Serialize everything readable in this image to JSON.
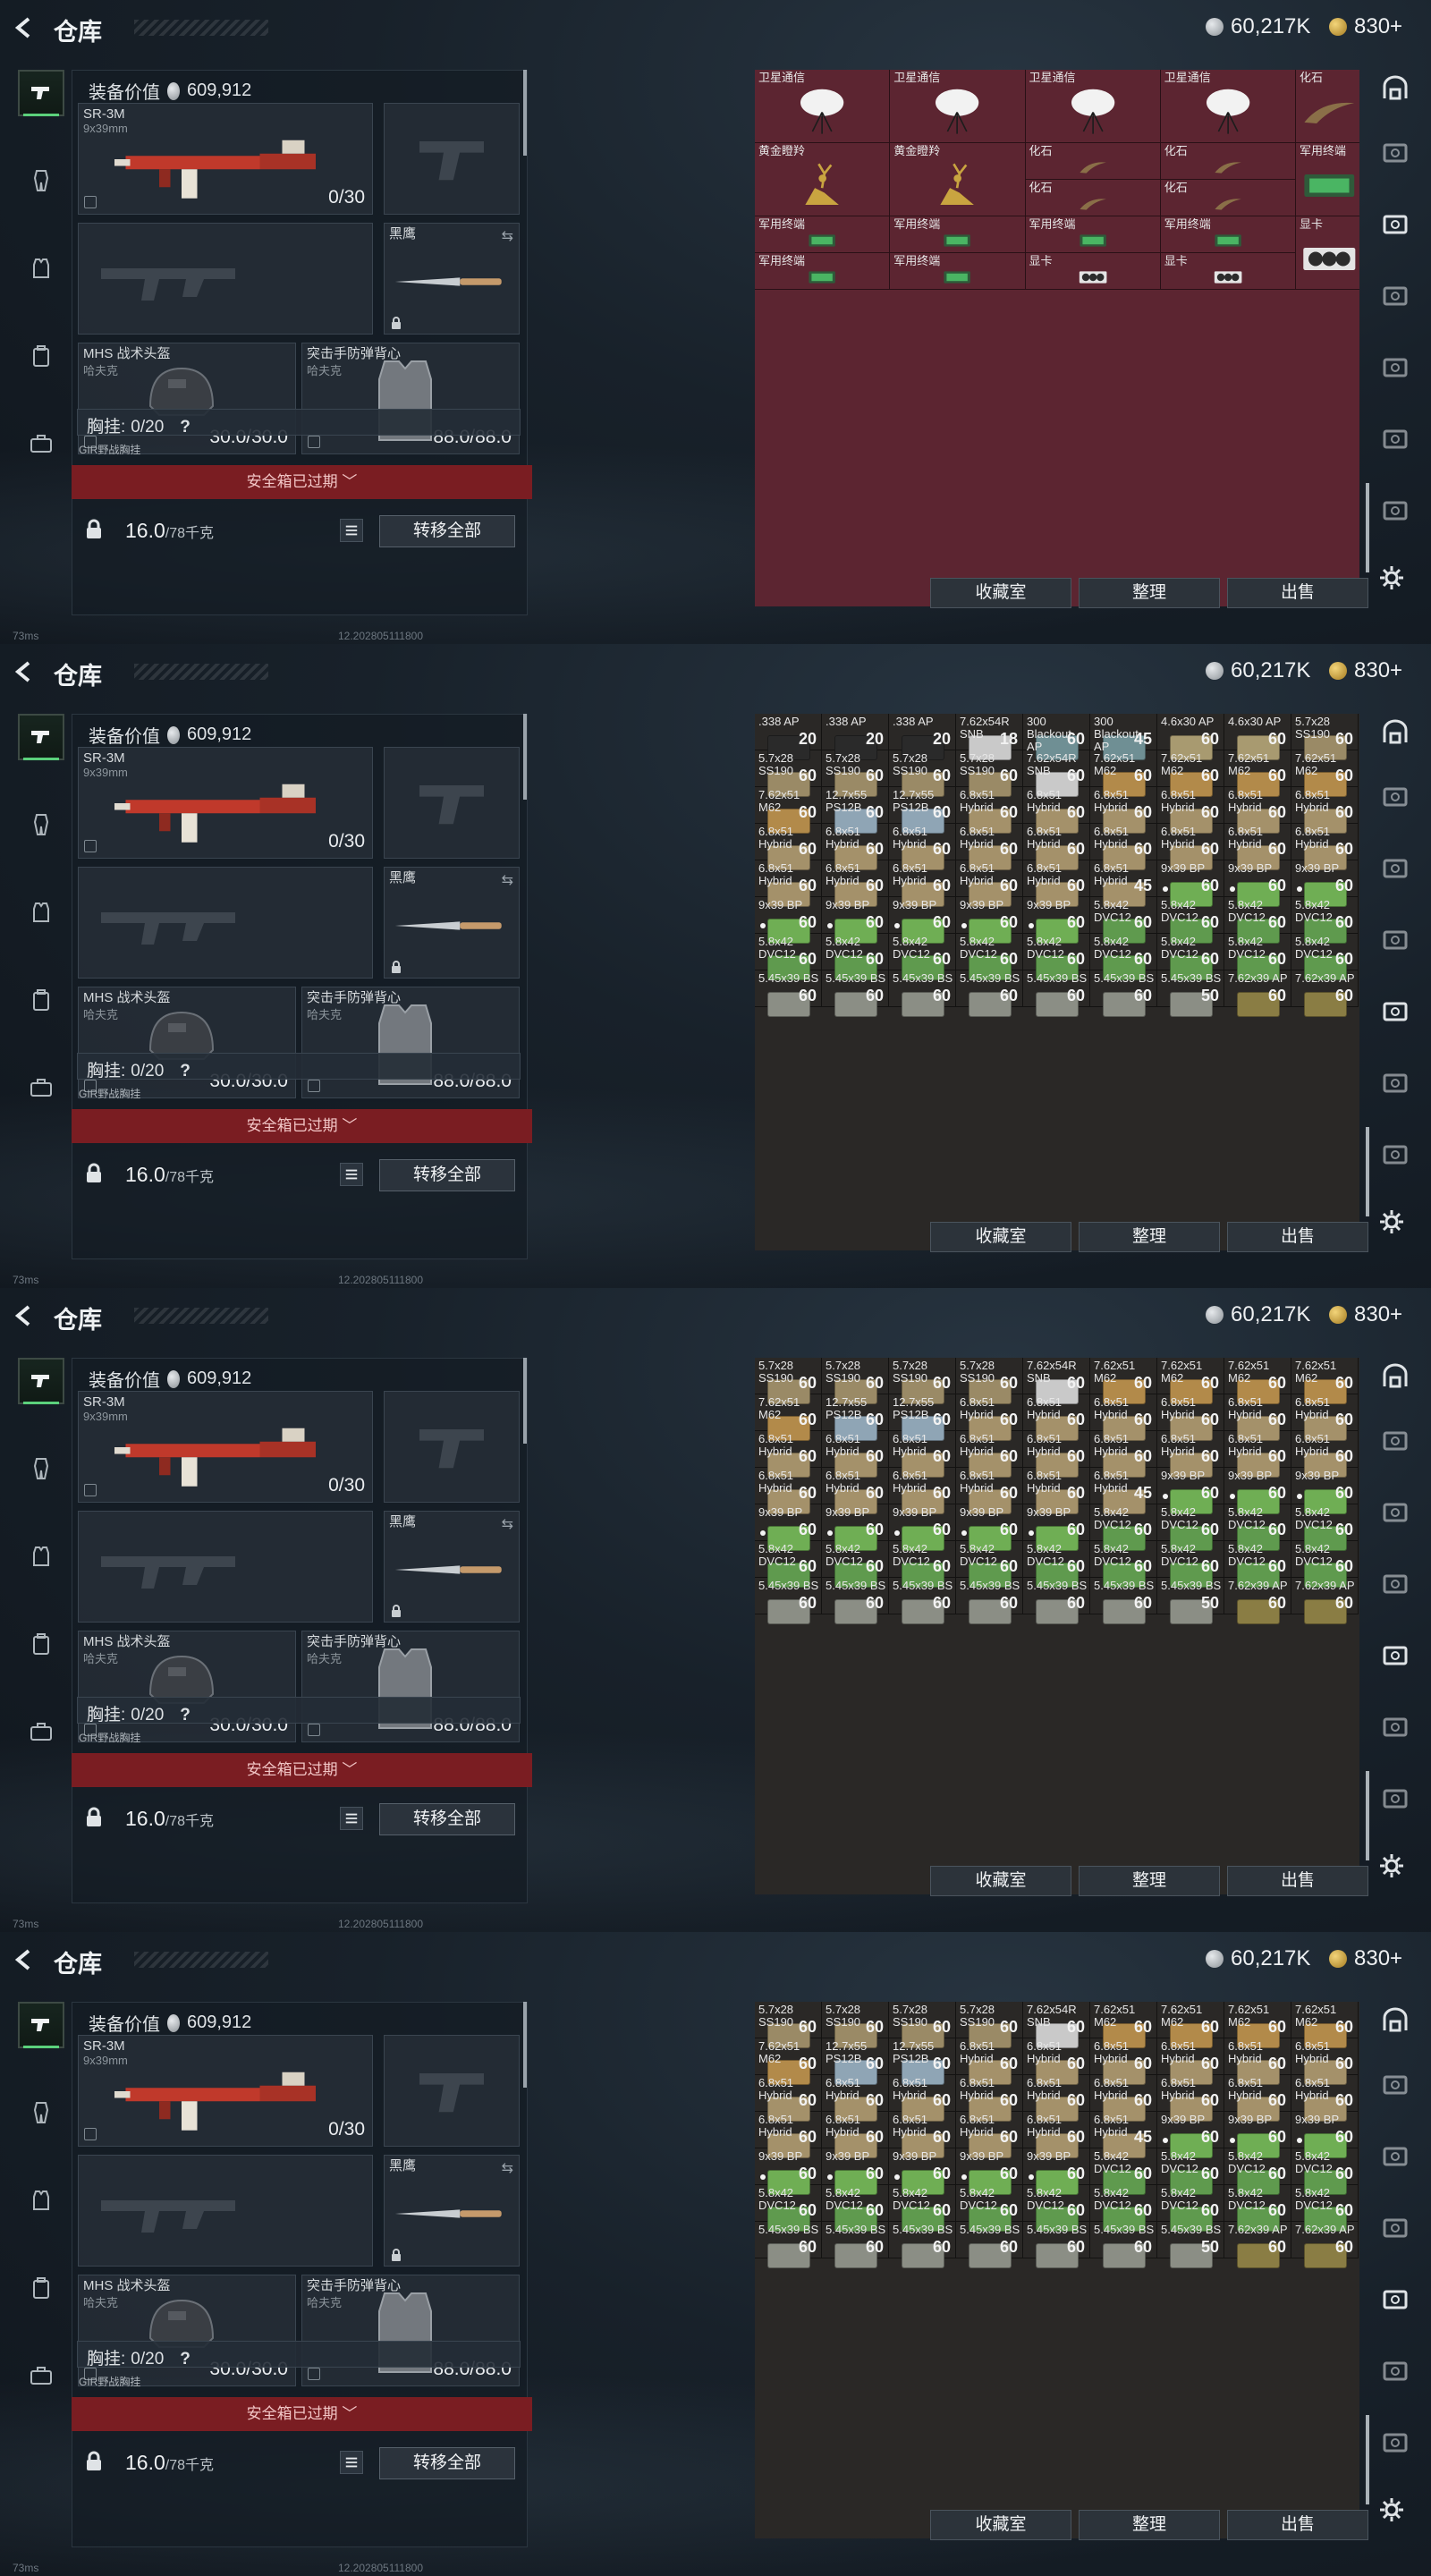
{
  "frames": [
    {
      "title": "仓库",
      "silver": "60,217K",
      "gold": "830+",
      "equip_label": "装备价值",
      "equip_value": "609,912",
      "weapon_name": "SR-3M",
      "weapon_cal": "9x39mm",
      "weapon_ammo": "0/30",
      "knife_name": "黑鹰",
      "helmet_name": "MHS 战术头盔",
      "helmet_sub": "哈夫克",
      "helmet_dur": "30.0/30.0",
      "armor_name": "突击手防弹背心",
      "armor_sub": "哈夫克",
      "armor_dur": "88.0/88.0",
      "chest_label": "胸挂:",
      "chest_value": "0/20",
      "chest_q": "?",
      "gird_label": "GIR野战胸挂",
      "expired_label": "安全箱已过期 ﹀",
      "weight_value": "16.0",
      "weight_max": "/78千克",
      "move_label": "转移全部",
      "collect_label": "收藏室",
      "sort_label": "整理",
      "sell_label": "出售",
      "footer_ms": "73ms",
      "footer_ver": "12.202805111800"
    },
    {
      "title": "仓库",
      "silver": "60,217K",
      "gold": "830+",
      "equip_label": "装备价值",
      "equip_value": "609,912",
      "weapon_name": "SR-3M",
      "weapon_cal": "9x39mm",
      "weapon_ammo": "0/30",
      "knife_name": "黑鹰",
      "helmet_name": "MHS 战术头盔",
      "helmet_sub": "哈夫克",
      "helmet_dur": "30.0/30.0",
      "armor_name": "突击手防弹背心",
      "armor_sub": "哈夫克",
      "armor_dur": "88.0/88.0",
      "chest_label": "胸挂:",
      "chest_value": "0/20",
      "chest_q": "?",
      "gird_label": "GIR野战胸挂",
      "expired_label": "安全箱已过期 ﹀",
      "weight_value": "16.0",
      "weight_max": "/78千克",
      "move_label": "转移全部",
      "collect_label": "收藏室",
      "sort_label": "整理",
      "sell_label": "出售",
      "footer_ms": "73ms",
      "footer_ver": "12.202805111800"
    },
    {
      "title": "仓库",
      "silver": "60,217K",
      "gold": "830+",
      "equip_label": "装备价值",
      "equip_value": "609,912",
      "weapon_name": "SR-3M",
      "weapon_cal": "9x39mm",
      "weapon_ammo": "0/30",
      "knife_name": "黑鹰",
      "helmet_name": "MHS 战术头盔",
      "helmet_sub": "哈夫克",
      "helmet_dur": "30.0/30.0",
      "armor_name": "突击手防弹背心",
      "armor_sub": "哈夫克",
      "armor_dur": "88.0/88.0",
      "chest_label": "胸挂:",
      "chest_value": "0/20",
      "chest_q": "?",
      "gird_label": "GIR野战胸挂",
      "expired_label": "安全箱已过期 ﹀",
      "weight_value": "16.0",
      "weight_max": "/78千克",
      "move_label": "转移全部",
      "collect_label": "收藏室",
      "sort_label": "整理",
      "sell_label": "出售",
      "footer_ms": "73ms",
      "footer_ver": "12.202805111800"
    },
    {
      "title": "仓库",
      "silver": "60,217K",
      "gold": "830+",
      "equip_label": "装备价值",
      "equip_value": "609,912",
      "weapon_name": "SR-3M",
      "weapon_cal": "9x39mm",
      "weapon_ammo": "0/30",
      "knife_name": "黑鹰",
      "helmet_name": "MHS 战术头盔",
      "helmet_sub": "哈夫克",
      "helmet_dur": "30.0/30.0",
      "armor_name": "突击手防弹背心",
      "armor_sub": "哈夫克",
      "armor_dur": "88.0/88.0",
      "chest_label": "胸挂:",
      "chest_value": "0/20",
      "chest_q": "?",
      "gird_label": "GIR野战胸挂",
      "expired_label": "安全箱已过期 ﹀",
      "weight_value": "16.0",
      "weight_max": "/78千克",
      "move_label": "转移全部",
      "collect_label": "收藏室",
      "sort_label": "整理",
      "sell_label": "出售",
      "footer_ms": "73ms",
      "footer_ver": "12.202805111800"
    }
  ],
  "grid1": {
    "theme": "maroon",
    "items": [
      {
        "name": "卫星通信",
        "r": 0,
        "c": 0,
        "w": 1,
        "h": 2,
        "kind": "dish"
      },
      {
        "name": "卫星通信",
        "r": 0,
        "c": 1,
        "w": 1,
        "h": 2,
        "kind": "dish"
      },
      {
        "name": "卫星通信",
        "r": 0,
        "c": 2,
        "w": 1,
        "h": 2,
        "kind": "dish"
      },
      {
        "name": "卫星通信",
        "r": 0,
        "c": 3,
        "w": 1,
        "h": 2,
        "kind": "dish"
      },
      {
        "name": "化石",
        "r": 0,
        "c": 4,
        "w": 0.5,
        "h": 2,
        "kind": "fossil"
      },
      {
        "name": "黄金瞪羚",
        "r": 2,
        "c": 0,
        "w": 1,
        "h": 2,
        "kind": "gazelle"
      },
      {
        "name": "黄金瞪羚",
        "r": 2,
        "c": 1,
        "w": 1,
        "h": 2,
        "kind": "gazelle"
      },
      {
        "name": "化石",
        "r": 2,
        "c": 2,
        "w": 1,
        "h": 1,
        "kind": "fossil"
      },
      {
        "name": "化石",
        "r": 2,
        "c": 3,
        "w": 1,
        "h": 1,
        "kind": "fossil"
      },
      {
        "name": "军用终端",
        "r": 2,
        "c": 4,
        "w": 0.5,
        "h": 2,
        "kind": "terminal"
      },
      {
        "name": "化石",
        "r": 3,
        "c": 2,
        "w": 1,
        "h": 1,
        "kind": "fossil"
      },
      {
        "name": "化石",
        "r": 3,
        "c": 3,
        "w": 1,
        "h": 1,
        "kind": "fossil"
      },
      {
        "name": "军用终端",
        "r": 4,
        "c": 0,
        "w": 1,
        "h": 1,
        "kind": "terminal"
      },
      {
        "name": "军用终端",
        "r": 4,
        "c": 1,
        "w": 1,
        "h": 1,
        "kind": "terminal"
      },
      {
        "name": "军用终端",
        "r": 4,
        "c": 2,
        "w": 1,
        "h": 1,
        "kind": "terminal"
      },
      {
        "name": "军用终端",
        "r": 4,
        "c": 3,
        "w": 1,
        "h": 1,
        "kind": "terminal"
      },
      {
        "name": "显卡",
        "r": 4,
        "c": 4,
        "w": 0.5,
        "h": 2,
        "kind": "gpu"
      },
      {
        "name": "军用终端",
        "r": 5,
        "c": 0,
        "w": 1,
        "h": 1,
        "kind": "terminal"
      },
      {
        "name": "军用终端",
        "r": 5,
        "c": 1,
        "w": 1,
        "h": 1,
        "kind": "terminal"
      },
      {
        "name": "显卡",
        "r": 5,
        "c": 2,
        "w": 1,
        "h": 1,
        "kind": "gpu"
      },
      {
        "name": "显卡",
        "r": 5,
        "c": 3,
        "w": 1,
        "h": 1,
        "kind": "gpu"
      }
    ]
  },
  "ammo_rows": {
    "r0": [
      ".338 AP 20",
      ".338 AP 20",
      ".338 AP 20",
      "7.62x54R SNB 18",
      "300 Blackout AP 60",
      "300 Blackout AP 45",
      "4.6x30 AP 60",
      "4.6x30 AP 60",
      "5.7x28 SS190 60"
    ],
    "r1": [
      "5.7x28 SS190 60",
      "5.7x28 SS190 60",
      "5.7x28 SS190 60",
      "5.7x28 SS190 60",
      "7.62x54R SNB 60",
      "7.62x51 M62 60",
      "7.62x51 M62 60",
      "7.62x51 M62 60",
      "7.62x51 M62 60"
    ],
    "r2": [
      "7.62x51 M62 60",
      "12.7x55 PS12B 60",
      "12.7x55 PS12B 60",
      "6.8x51 Hybrid 60",
      "6.8x51 Hybrid 60",
      "6.8x51 Hybrid 60",
      "6.8x51 Hybrid 60",
      "6.8x51 Hybrid 60",
      "6.8x51 Hybrid 60"
    ],
    "r3": [
      "6.8x51 Hybrid 60",
      "6.8x51 Hybrid 60",
      "6.8x51 Hybrid 60",
      "6.8x51 Hybrid 60",
      "6.8x51 Hybrid 60",
      "6.8x51 Hybrid 60",
      "6.8x51 Hybrid 60",
      "6.8x51 Hybrid 60",
      "6.8x51 Hybrid 60"
    ],
    "r4": [
      "6.8x51 Hybrid 60",
      "6.8x51 Hybrid 60",
      "6.8x51 Hybrid 60",
      "6.8x51 Hybrid 60",
      "6.8x51 Hybrid 60",
      "6.8x51 Hybrid 45",
      "9x39 BP 60",
      "9x39 BP 60",
      "9x39 BP 60"
    ],
    "r5": [
      "9x39 BP 60",
      "9x39 BP 60",
      "9x39 BP 60",
      "9x39 BP 60",
      "9x39 BP 60",
      "5.8x42 DVC12 60",
      "5.8x42 DVC12 60",
      "5.8x42 DVC12 60",
      "5.8x42 DVC12 60"
    ],
    "r6": [
      "5.8x42 DVC12 60",
      "5.8x42 DVC12 60",
      "5.8x42 DVC12 60",
      "5.8x42 DVC12 60",
      "5.8x42 DVC12 60",
      "5.8x42 DVC12 60",
      "5.8x42 DVC12 60",
      "5.8x42 DVC12 60",
      "5.8x42 DVC12 60"
    ],
    "r7": [
      "5.45x39 BS 60",
      "5.45x39 BS 60",
      "5.45x39 BS 60",
      "5.45x39 BS 60",
      "5.45x39 BS 60",
      "5.45x39 BS 60",
      "5.45x39 BS 50",
      "7.62x39 AP 60",
      "7.62x39 AP 60"
    ]
  }
}
